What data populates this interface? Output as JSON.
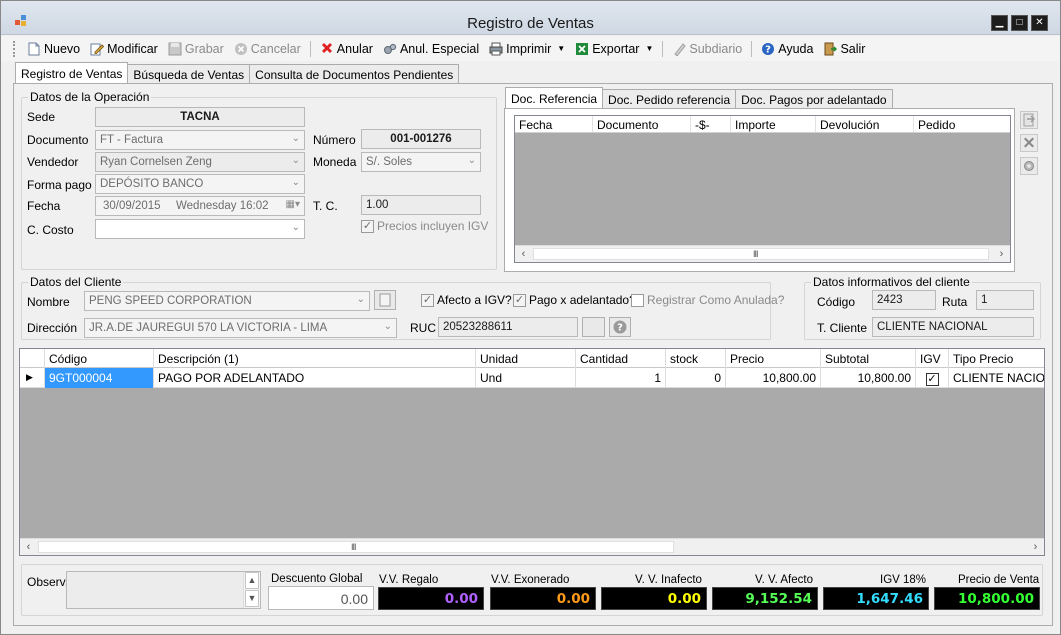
{
  "window": {
    "title": "Registro de Ventas"
  },
  "toolbar": {
    "nuevo": "Nuevo",
    "modificar": "Modificar",
    "grabar": "Grabar",
    "cancelar": "Cancelar",
    "anular": "Anular",
    "anul_especial": "Anul. Especial",
    "imprimir": "Imprimir",
    "exportar": "Exportar",
    "subdiario": "Subdiario",
    "ayuda": "Ayuda",
    "salir": "Salir"
  },
  "tabs": [
    "Registro de Ventas",
    "Búsqueda de Ventas",
    "Consulta de Documentos Pendientes"
  ],
  "operacion": {
    "group_label": "Datos de la Operación",
    "sede_label": "Sede",
    "sede": "TACNA",
    "documento_label": "Documento",
    "documento": "FT - Factura",
    "numero_label": "Número",
    "numero": "001-001276",
    "vendedor_label": "Vendedor",
    "vendedor": "Ryan Cornelsen Zeng",
    "moneda_label": "Moneda",
    "moneda": "S/. Soles",
    "forma_pago_label": "Forma pago",
    "forma_pago": "DEPÓSITO BANCO",
    "fecha_label": "Fecha",
    "fecha": "30/09/2015",
    "fecha_dia": "Wednesday 16:02",
    "tc_label": "T. C.",
    "tc": "1.00",
    "costo_label": "C. Costo",
    "costo": "",
    "precios_igv": "Precios incluyen IGV"
  },
  "referencia": {
    "tabs": [
      "Doc. Referencia",
      "Doc. Pedido referencia",
      "Doc. Pagos por adelantado"
    ],
    "columns": [
      "Fecha",
      "Documento",
      "-$-",
      "Importe",
      "Devolución",
      "Pedido"
    ]
  },
  "cliente": {
    "group_label": "Datos del Cliente",
    "nombre_label": "Nombre",
    "nombre": "PENG SPEED CORPORATION",
    "direccion_label": "Dirección",
    "direccion": "JR.A.DE JAUREGUI 570 LA VICTORIA - LIMA",
    "afecto_igv": "Afecto a IGV?",
    "pago_adelantado": "Pago x adelantado?",
    "registrar_anulada": "Registrar Como Anulada?",
    "ruc_label": "RUC",
    "ruc": "20523288611"
  },
  "info_cliente": {
    "group_label": "Datos informativos del cliente",
    "codigo_label": "Código",
    "codigo": "2423",
    "ruta_label": "Ruta",
    "ruta": "1",
    "tcliente_label": "T. Cliente",
    "tcliente": "CLIENTE NACIONAL"
  },
  "detalle": {
    "columns": [
      "Código",
      "Descripción (1)",
      "Unidad",
      "Cantidad",
      "stock",
      "Precio",
      "Subtotal",
      "IGV",
      "Tipo Precio"
    ],
    "rows": [
      {
        "codigo": "9GT000004",
        "descripcion": "PAGO POR ADELANTADO",
        "unidad": "Und",
        "cantidad": "1",
        "stock": "0",
        "precio": "10,800.00",
        "subtotal": "10,800.00",
        "igv": "✓",
        "tipo_precio": "CLIENTE NACIONAL"
      }
    ]
  },
  "totales": {
    "observ_label": "Observ.",
    "descuento_label": "Descuento Global",
    "descuento": "0.00",
    "vv_regalo_label": "V.V. Regalo",
    "vv_regalo": "0.00",
    "vv_exonerado_label": "V.V. Exonerado",
    "vv_exonerado": "0.00",
    "vv_inafecto_label": "V. V. Inafecto",
    "vv_inafecto": "0.00",
    "vv_afecto_label": "V. V. Afecto",
    "vv_afecto": "9,152.54",
    "igv_label": "IGV 18%",
    "igv": "1,647.46",
    "precio_venta_label": "Precio de Venta",
    "precio_venta": "10,800.00"
  },
  "colors": {
    "vv_regalo": "#b060ff",
    "vv_exonerado": "#ff9a1a",
    "vv_inafecto": "#ffff00",
    "vv_afecto": "#55ff55",
    "igv": "#33ddff",
    "precio_venta": "#33ff33",
    "selection": "#3399ff"
  }
}
